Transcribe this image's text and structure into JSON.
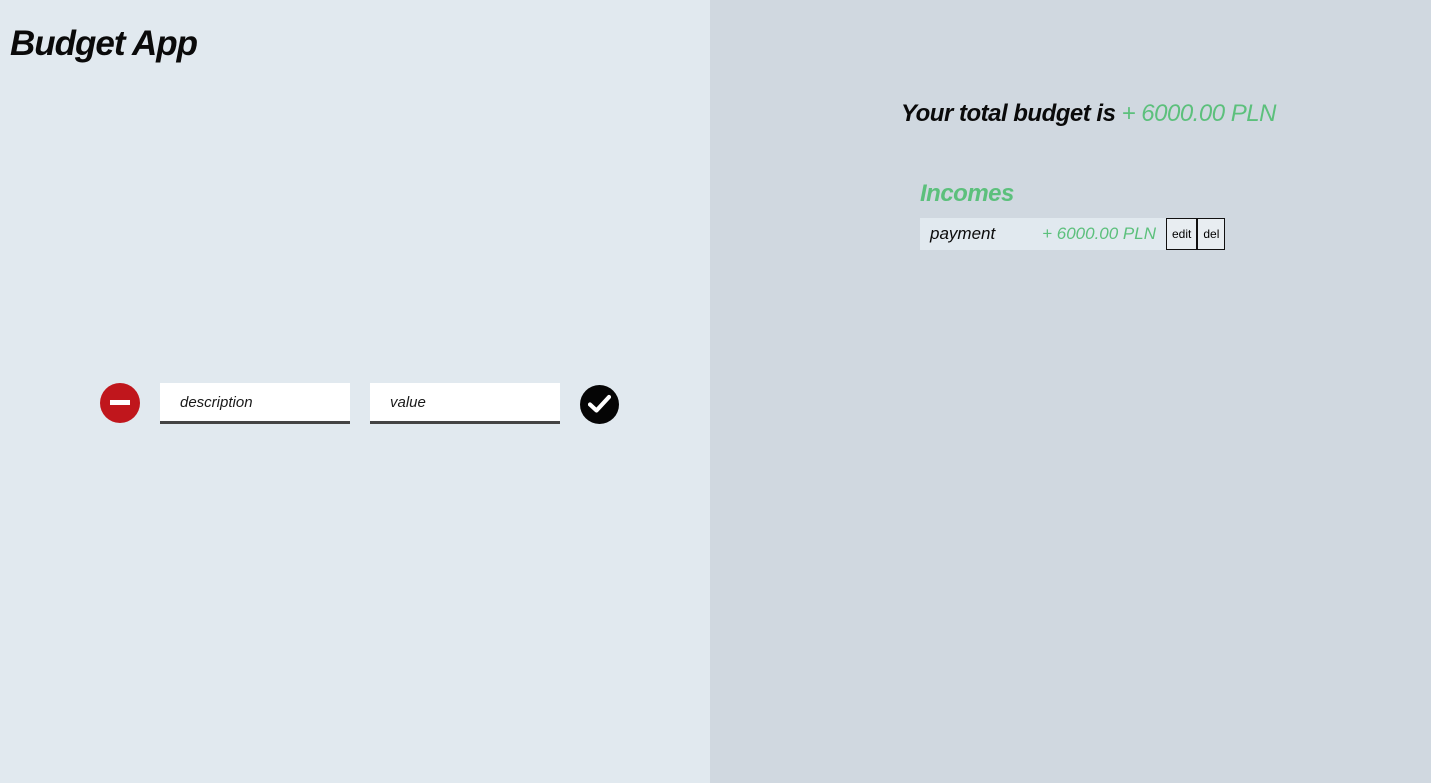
{
  "app": {
    "title": "Budget App"
  },
  "form": {
    "description_placeholder": "description",
    "value_placeholder": "value",
    "type_toggle_icon": "minus-circle-icon",
    "confirm_icon": "check-circle-icon",
    "type_toggle_color": "#c0161c"
  },
  "summary": {
    "label": "Your total budget is",
    "amount": "+ 6000.00 PLN",
    "positive_color": "#5cc07c"
  },
  "incomes": {
    "heading": "Incomes",
    "items": [
      {
        "description": "payment",
        "value": "+ 6000.00 PLN",
        "edit_label": "edit",
        "delete_label": "del"
      }
    ]
  }
}
